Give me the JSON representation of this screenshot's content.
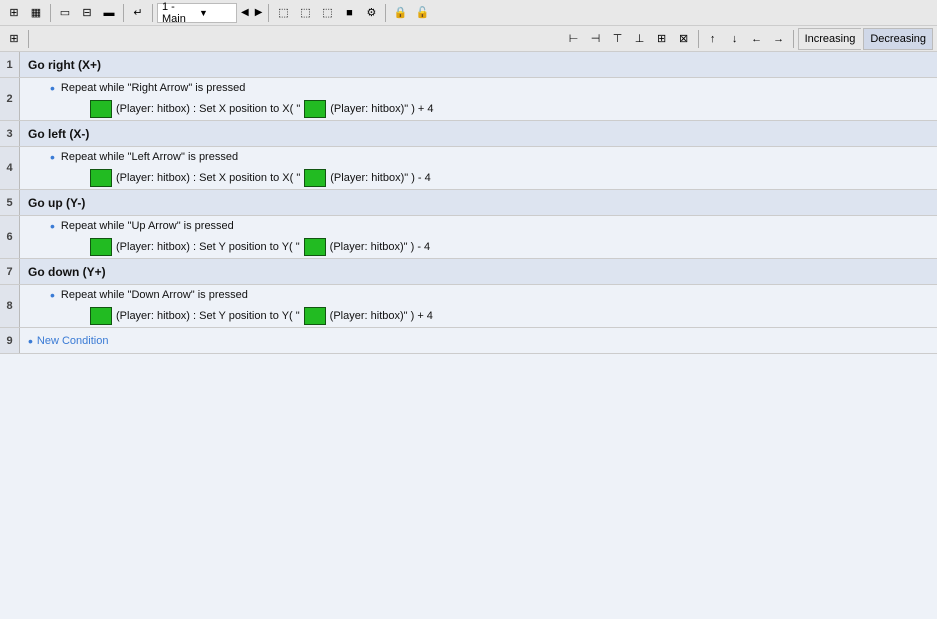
{
  "toolbar1": {
    "icons": [
      "grid-small",
      "grid-large",
      "panel-left",
      "panel-grid",
      "panel-right",
      "arrow-hook",
      "dropdown-main"
    ],
    "dropdown_label": "1 - Main",
    "nav_prev": "◀",
    "nav_next": "▶",
    "icons2": [
      "event-icon",
      "subevent-icon",
      "global-icon",
      "stop-icon",
      "more-icon"
    ]
  },
  "toolbar2": {
    "icons_left": [
      "table-icon"
    ],
    "icons_right": [
      "icon1",
      "icon2",
      "icon3",
      "icon4",
      "icon5",
      "icon6",
      "icon7",
      "icon8",
      "icon9",
      "icon10",
      "icon11",
      "icon12"
    ],
    "increasing_label": "Increasing",
    "decreasing_label": "Decreasing"
  },
  "rows": [
    {
      "num": "1",
      "type": "header",
      "label": "Go right (X+)",
      "children": [
        {
          "num": "2",
          "type": "condition",
          "text": "Repeat while \"Right Arrow\" is pressed",
          "action": {
            "num": "",
            "text_before": "(Player: hitbox) : Set X position to X( \"",
            "text_after": "(Player: hitbox)\" ) + 4"
          }
        }
      ]
    },
    {
      "num": "3",
      "type": "header",
      "label": "Go left (X-)",
      "children": [
        {
          "num": "4",
          "type": "condition",
          "text": "Repeat while \"Left Arrow\" is pressed",
          "action": {
            "num": "",
            "text_before": "(Player: hitbox) : Set X position to X( \"",
            "text_after": "(Player: hitbox)\" ) - 4"
          }
        }
      ]
    },
    {
      "num": "5",
      "type": "header",
      "label": "Go up (Y-)",
      "children": [
        {
          "num": "6",
          "type": "condition",
          "text": "Repeat while \"Up Arrow\" is pressed",
          "action": {
            "num": "",
            "text_before": "(Player: hitbox) : Set Y position to Y( \"",
            "text_after": "(Player: hitbox)\" ) - 4"
          }
        }
      ]
    },
    {
      "num": "7",
      "type": "header",
      "label": "Go down (Y+)",
      "children": [
        {
          "num": "8",
          "type": "condition",
          "text": "Repeat while \"Down Arrow\" is pressed",
          "action": {
            "num": "",
            "text_before": "(Player: hitbox) : Set Y position to Y( \"",
            "text_after": "(Player: hitbox)\" ) + 4"
          }
        }
      ]
    },
    {
      "num": "9",
      "type": "new-condition",
      "label": "New Condition"
    }
  ]
}
